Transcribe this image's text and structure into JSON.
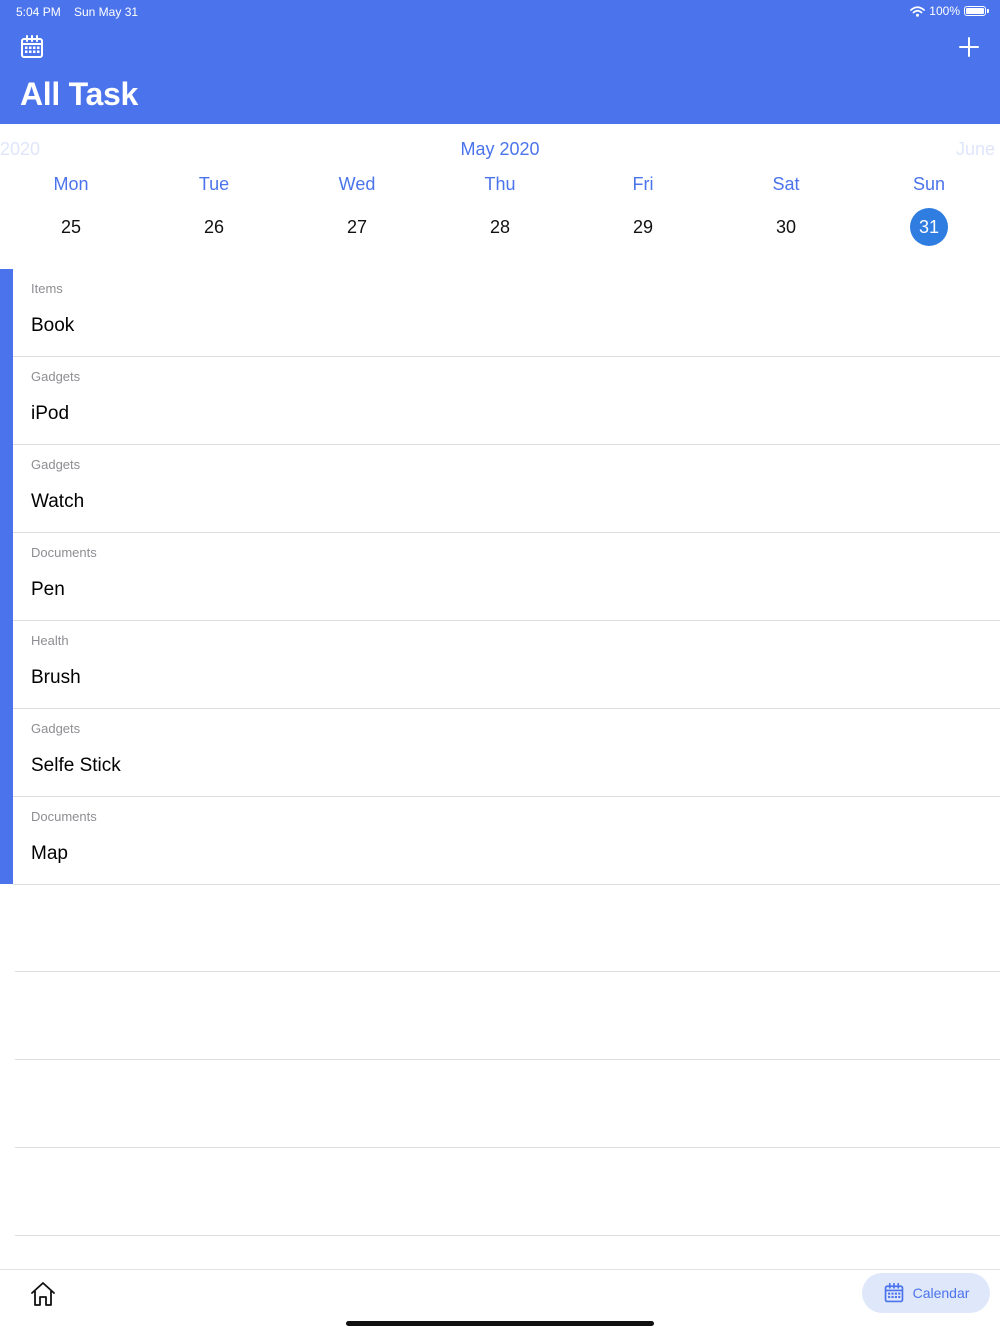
{
  "status_bar": {
    "time": "5:04 PM",
    "date": "Sun May 31",
    "battery": "100%"
  },
  "header": {
    "title": "All Task",
    "calendar_icon": "calendar-icon",
    "add_icon": "plus-icon"
  },
  "calendar": {
    "prev_month": "2020",
    "current_month": "May 2020",
    "next_month": "June",
    "weekdays": [
      "Mon",
      "Tue",
      "Wed",
      "Thu",
      "Fri",
      "Sat",
      "Sun"
    ],
    "dates": [
      "25",
      "26",
      "27",
      "28",
      "29",
      "30",
      "31"
    ],
    "selected_date": "31"
  },
  "tasks": [
    {
      "category": "Items",
      "name": "Book"
    },
    {
      "category": "Gadgets",
      "name": "iPod"
    },
    {
      "category": "Gadgets",
      "name": "Watch"
    },
    {
      "category": "Documents",
      "name": "Pen"
    },
    {
      "category": "Health",
      "name": "Brush"
    },
    {
      "category": "Gadgets",
      "name": "Selfe Stick"
    },
    {
      "category": "Documents",
      "name": "Map"
    }
  ],
  "tabbar": {
    "home_icon": "home-icon",
    "calendar_label": "Calendar"
  },
  "colors": {
    "accent": "#4b74ec",
    "selected": "#2f7de0",
    "tab_bg": "#dfe7fb"
  }
}
